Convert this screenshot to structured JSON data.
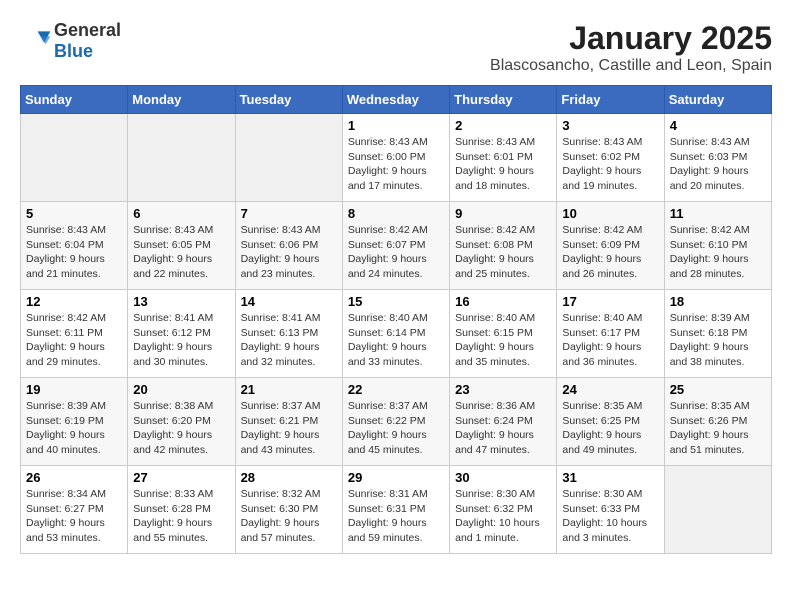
{
  "app": {
    "name_general": "General",
    "name_blue": "Blue"
  },
  "header": {
    "title": "January 2025",
    "subtitle": "Blascosancho, Castille and Leon, Spain"
  },
  "weekdays": [
    "Sunday",
    "Monday",
    "Tuesday",
    "Wednesday",
    "Thursday",
    "Friday",
    "Saturday"
  ],
  "weeks": [
    [
      {
        "day": "",
        "sunrise": "",
        "sunset": "",
        "daylight": ""
      },
      {
        "day": "",
        "sunrise": "",
        "sunset": "",
        "daylight": ""
      },
      {
        "day": "",
        "sunrise": "",
        "sunset": "",
        "daylight": ""
      },
      {
        "day": "1",
        "sunrise": "Sunrise: 8:43 AM",
        "sunset": "Sunset: 6:00 PM",
        "daylight": "Daylight: 9 hours and 17 minutes."
      },
      {
        "day": "2",
        "sunrise": "Sunrise: 8:43 AM",
        "sunset": "Sunset: 6:01 PM",
        "daylight": "Daylight: 9 hours and 18 minutes."
      },
      {
        "day": "3",
        "sunrise": "Sunrise: 8:43 AM",
        "sunset": "Sunset: 6:02 PM",
        "daylight": "Daylight: 9 hours and 19 minutes."
      },
      {
        "day": "4",
        "sunrise": "Sunrise: 8:43 AM",
        "sunset": "Sunset: 6:03 PM",
        "daylight": "Daylight: 9 hours and 20 minutes."
      }
    ],
    [
      {
        "day": "5",
        "sunrise": "Sunrise: 8:43 AM",
        "sunset": "Sunset: 6:04 PM",
        "daylight": "Daylight: 9 hours and 21 minutes."
      },
      {
        "day": "6",
        "sunrise": "Sunrise: 8:43 AM",
        "sunset": "Sunset: 6:05 PM",
        "daylight": "Daylight: 9 hours and 22 minutes."
      },
      {
        "day": "7",
        "sunrise": "Sunrise: 8:43 AM",
        "sunset": "Sunset: 6:06 PM",
        "daylight": "Daylight: 9 hours and 23 minutes."
      },
      {
        "day": "8",
        "sunrise": "Sunrise: 8:42 AM",
        "sunset": "Sunset: 6:07 PM",
        "daylight": "Daylight: 9 hours and 24 minutes."
      },
      {
        "day": "9",
        "sunrise": "Sunrise: 8:42 AM",
        "sunset": "Sunset: 6:08 PM",
        "daylight": "Daylight: 9 hours and 25 minutes."
      },
      {
        "day": "10",
        "sunrise": "Sunrise: 8:42 AM",
        "sunset": "Sunset: 6:09 PM",
        "daylight": "Daylight: 9 hours and 26 minutes."
      },
      {
        "day": "11",
        "sunrise": "Sunrise: 8:42 AM",
        "sunset": "Sunset: 6:10 PM",
        "daylight": "Daylight: 9 hours and 28 minutes."
      }
    ],
    [
      {
        "day": "12",
        "sunrise": "Sunrise: 8:42 AM",
        "sunset": "Sunset: 6:11 PM",
        "daylight": "Daylight: 9 hours and 29 minutes."
      },
      {
        "day": "13",
        "sunrise": "Sunrise: 8:41 AM",
        "sunset": "Sunset: 6:12 PM",
        "daylight": "Daylight: 9 hours and 30 minutes."
      },
      {
        "day": "14",
        "sunrise": "Sunrise: 8:41 AM",
        "sunset": "Sunset: 6:13 PM",
        "daylight": "Daylight: 9 hours and 32 minutes."
      },
      {
        "day": "15",
        "sunrise": "Sunrise: 8:40 AM",
        "sunset": "Sunset: 6:14 PM",
        "daylight": "Daylight: 9 hours and 33 minutes."
      },
      {
        "day": "16",
        "sunrise": "Sunrise: 8:40 AM",
        "sunset": "Sunset: 6:15 PM",
        "daylight": "Daylight: 9 hours and 35 minutes."
      },
      {
        "day": "17",
        "sunrise": "Sunrise: 8:40 AM",
        "sunset": "Sunset: 6:17 PM",
        "daylight": "Daylight: 9 hours and 36 minutes."
      },
      {
        "day": "18",
        "sunrise": "Sunrise: 8:39 AM",
        "sunset": "Sunset: 6:18 PM",
        "daylight": "Daylight: 9 hours and 38 minutes."
      }
    ],
    [
      {
        "day": "19",
        "sunrise": "Sunrise: 8:39 AM",
        "sunset": "Sunset: 6:19 PM",
        "daylight": "Daylight: 9 hours and 40 minutes."
      },
      {
        "day": "20",
        "sunrise": "Sunrise: 8:38 AM",
        "sunset": "Sunset: 6:20 PM",
        "daylight": "Daylight: 9 hours and 42 minutes."
      },
      {
        "day": "21",
        "sunrise": "Sunrise: 8:37 AM",
        "sunset": "Sunset: 6:21 PM",
        "daylight": "Daylight: 9 hours and 43 minutes."
      },
      {
        "day": "22",
        "sunrise": "Sunrise: 8:37 AM",
        "sunset": "Sunset: 6:22 PM",
        "daylight": "Daylight: 9 hours and 45 minutes."
      },
      {
        "day": "23",
        "sunrise": "Sunrise: 8:36 AM",
        "sunset": "Sunset: 6:24 PM",
        "daylight": "Daylight: 9 hours and 47 minutes."
      },
      {
        "day": "24",
        "sunrise": "Sunrise: 8:35 AM",
        "sunset": "Sunset: 6:25 PM",
        "daylight": "Daylight: 9 hours and 49 minutes."
      },
      {
        "day": "25",
        "sunrise": "Sunrise: 8:35 AM",
        "sunset": "Sunset: 6:26 PM",
        "daylight": "Daylight: 9 hours and 51 minutes."
      }
    ],
    [
      {
        "day": "26",
        "sunrise": "Sunrise: 8:34 AM",
        "sunset": "Sunset: 6:27 PM",
        "daylight": "Daylight: 9 hours and 53 minutes."
      },
      {
        "day": "27",
        "sunrise": "Sunrise: 8:33 AM",
        "sunset": "Sunset: 6:28 PM",
        "daylight": "Daylight: 9 hours and 55 minutes."
      },
      {
        "day": "28",
        "sunrise": "Sunrise: 8:32 AM",
        "sunset": "Sunset: 6:30 PM",
        "daylight": "Daylight: 9 hours and 57 minutes."
      },
      {
        "day": "29",
        "sunrise": "Sunrise: 8:31 AM",
        "sunset": "Sunset: 6:31 PM",
        "daylight": "Daylight: 9 hours and 59 minutes."
      },
      {
        "day": "30",
        "sunrise": "Sunrise: 8:30 AM",
        "sunset": "Sunset: 6:32 PM",
        "daylight": "Daylight: 10 hours and 1 minute."
      },
      {
        "day": "31",
        "sunrise": "Sunrise: 8:30 AM",
        "sunset": "Sunset: 6:33 PM",
        "daylight": "Daylight: 10 hours and 3 minutes."
      },
      {
        "day": "",
        "sunrise": "",
        "sunset": "",
        "daylight": ""
      }
    ]
  ]
}
